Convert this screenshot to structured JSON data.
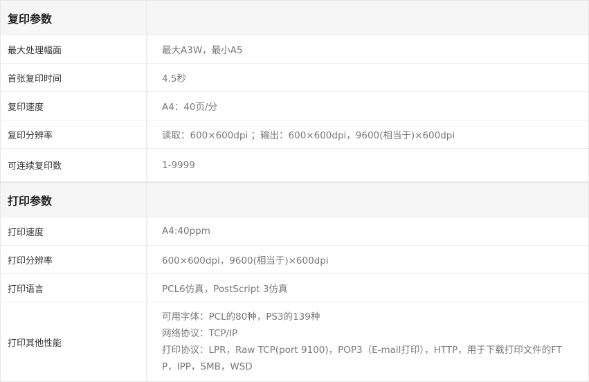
{
  "copy": {
    "title": "复印参数",
    "rows": [
      {
        "label": "最大处理幅面",
        "value": "最大A3W，最小A5"
      },
      {
        "label": "首张复印时间",
        "value": "4.5秒"
      },
      {
        "label": "复印速度",
        "value": "A4：40页/分"
      },
      {
        "label": "复印分辨率",
        "value": "读取：600×600dpi ；输出：600×600dpi，9600(相当于)×600dpi"
      },
      {
        "label": "可连续复印数",
        "value": "1-9999"
      }
    ]
  },
  "print": {
    "title": "打印参数",
    "rows": [
      {
        "label": "打印速度",
        "value": "A4:40ppm"
      },
      {
        "label": "打印分辨率",
        "value": "600×600dpi，9600(相当于)×600dpi"
      },
      {
        "label": "打印语言",
        "value": "PCL6仿真，PostScript 3仿真"
      }
    ],
    "other": {
      "label": "打印其他性能",
      "lines": [
        "可用字体：PCL的80种，PS3的139种",
        "网络协议：TCP/IP",
        "打印协议：LPR，Raw TCP(port 9100)，POP3（E-mail打印），HTTP，用于下载打印文件的FT",
        "P，IPP，SMB，WSD"
      ]
    }
  }
}
